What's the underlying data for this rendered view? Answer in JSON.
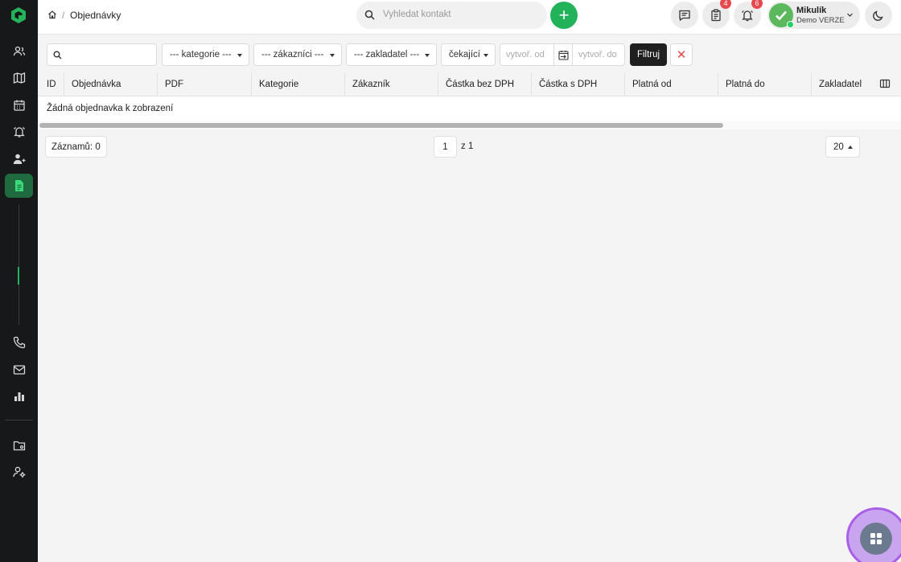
{
  "breadcrumb": {
    "current": "Objednávky"
  },
  "search": {
    "placeholder": "Vyhledat kontakt"
  },
  "header": {
    "add_label": "+",
    "tasks_badge": "4",
    "notifications_badge": "6",
    "user": {
      "name": "Mikulík",
      "subtitle": "Demo VERZE"
    }
  },
  "filters": {
    "category": "--- kategorie ---",
    "customers": "--- zákazníci ---",
    "founder": "--- zakladatel ---",
    "status": "čekající",
    "date_from_placeholder": "vytvoř. od",
    "date_to_placeholder": "vytvoř. do",
    "filter_button": "Filtruj",
    "clear_button": "✕"
  },
  "table": {
    "columns": [
      "ID",
      "Objednávka",
      "PDF",
      "Kategorie",
      "Zákazník",
      "Částka bez DPH",
      "Částka s DPH",
      "Platná od",
      "Platná do",
      "Zakladatel"
    ],
    "empty_message": "Žádná objednavka k zobrazení"
  },
  "footer": {
    "records": "Záznamů: 0",
    "page": "1",
    "page_of": "z 1",
    "per_page": "20"
  },
  "colors": {
    "sidebar_bg": "#17181a",
    "accent_green": "#22b25a",
    "active_nav": "#1f6b3f",
    "badge_red": "#e5484d",
    "fab_purple": "#a95fe8"
  },
  "icons": {
    "sidebar": [
      "logo-icon",
      "contacts-icon",
      "map-icon",
      "calendar-icon",
      "alarm-icon",
      "users-icon",
      "document-icon",
      "phone-icon",
      "mail-icon",
      "chart-icon",
      "folder-icon",
      "user-settings-icon"
    ],
    "header": [
      "home-icon",
      "search-icon",
      "plus-icon",
      "chat-icon",
      "clipboard-icon",
      "bell-icon",
      "moon-icon"
    ]
  }
}
